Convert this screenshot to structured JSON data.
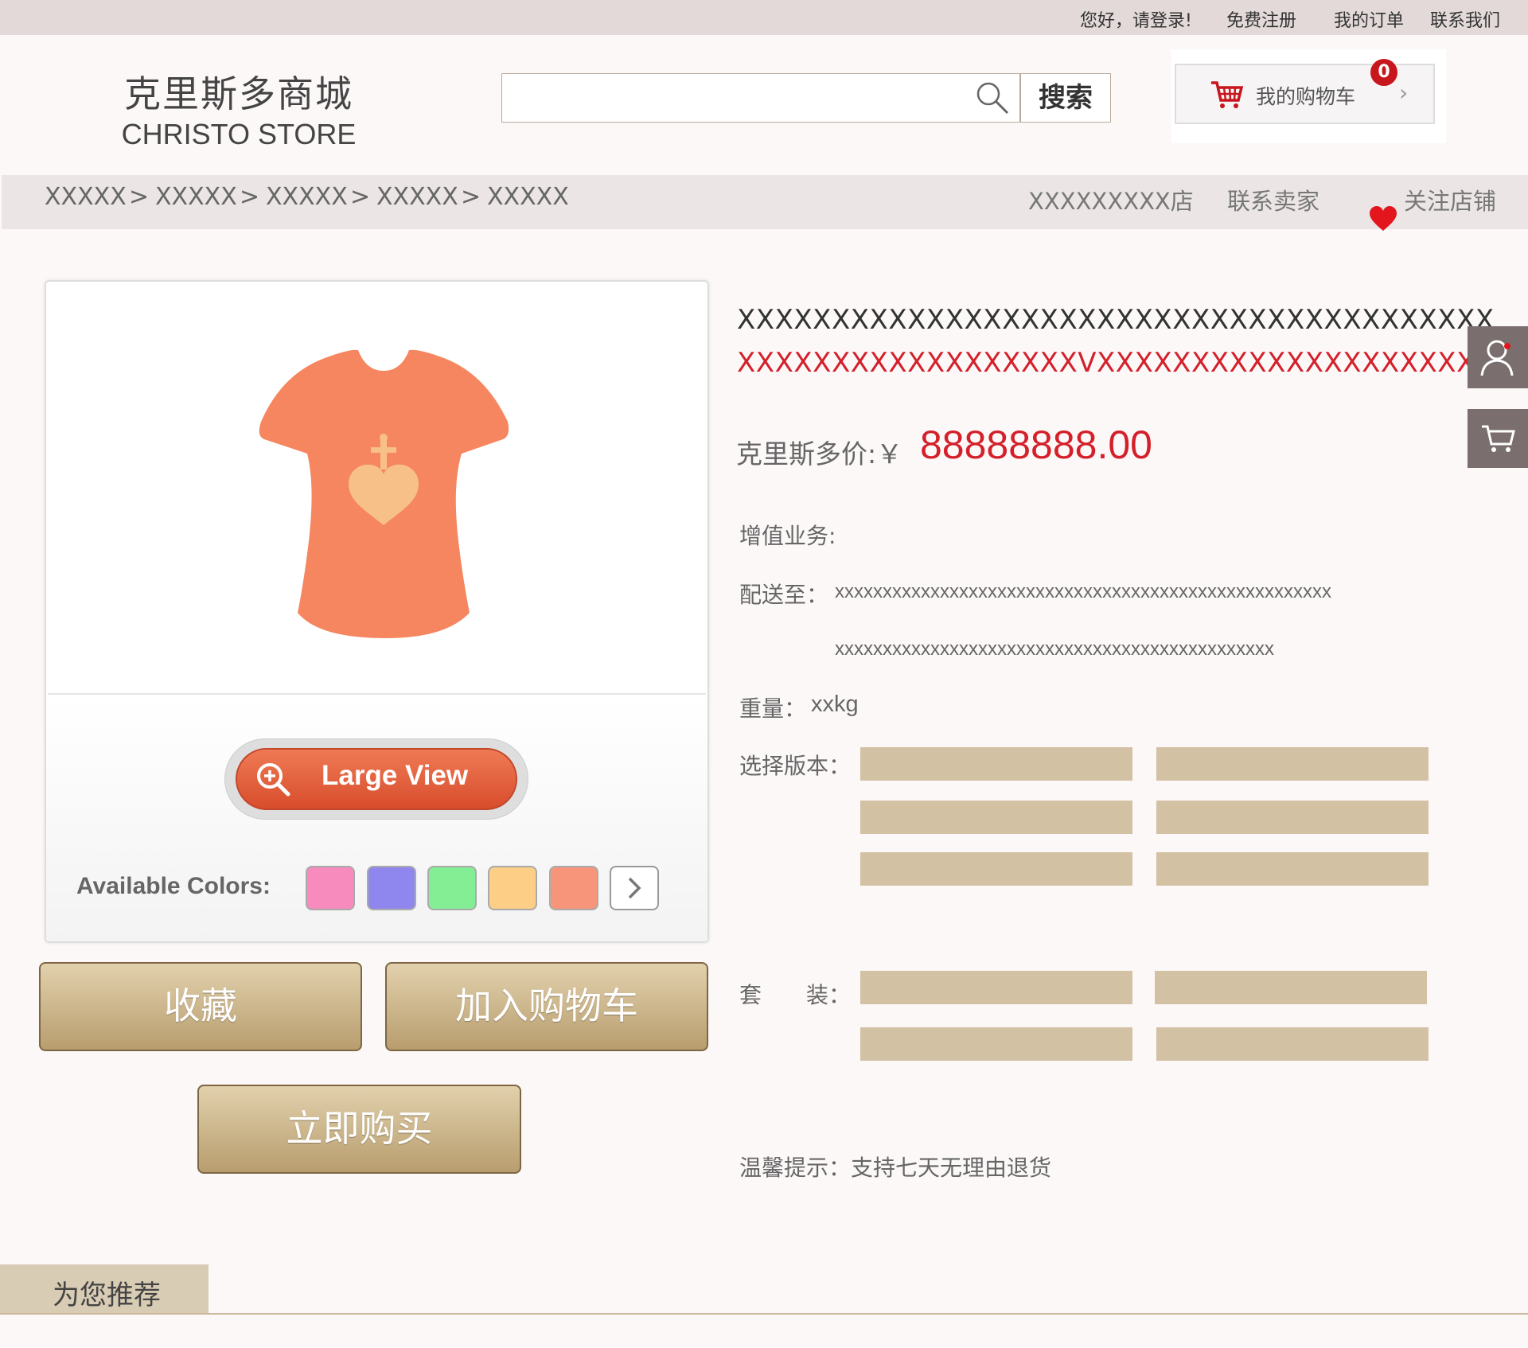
{
  "topbar": {
    "greeting": "您好，请登录!",
    "register": "免费注册",
    "orders": "我的订单",
    "contact": "联系我们"
  },
  "header": {
    "logo_cn": "克里斯多商城",
    "logo_en": "CHRISTO STORE",
    "search_placeholder": "",
    "search_button": "搜索",
    "cart_label": "我的购物车",
    "cart_count": "0",
    "cart_chevron": "›"
  },
  "breadcrumb": {
    "items": [
      "XXXXX",
      "XXXXX",
      "XXXXX",
      "XXXXX",
      "XXXXX"
    ],
    "separator": ">",
    "shop_name": "XXXXXXXXX店",
    "contact_seller": "联系卖家",
    "follow_shop": "关注店铺"
  },
  "gallery": {
    "large_view": "Large View",
    "colors_label": "Available Colors:",
    "colors": [
      "#f78bbd",
      "#8f87ee",
      "#84ee95",
      "#fcce86",
      "#f7957b"
    ],
    "next_icon": "chevron-right-icon"
  },
  "actions": {
    "favorite": "收藏",
    "add_to_cart": "加入购物车",
    "buy_now": "立即购买"
  },
  "product": {
    "title_line1": "XXXXXXXXXXXXXXXXXXXXXXXXXXXXXXXXXXXXXXXX",
    "title_line2": "XXXXXXXXXXXXXXXXXXVXXXXXXXXXXXXXXXXXXXXX",
    "price_label": "克里斯多价:￥",
    "price_value": "88888888.00",
    "value_added_label": "增值业务:",
    "ship_label": "配送至：",
    "ship_line1": "xxxxxxxxxxxxxxxxxxxxxxxxxxxxxxxxxxxxxxxxxxxxxxxxxxxx",
    "ship_line2": "xxxxxxxxxxxxxxxxxxxxxxxxxxxxxxxxxxxxxxxxxxxxxx",
    "weight_label": "重量：",
    "weight_value": "xxkg",
    "version_label": "选择版本：",
    "bundle_label": "套　　装：",
    "tip": "温馨提示：支持七天无理由退货"
  },
  "recommend": {
    "title": "为您推荐"
  },
  "colors": {
    "price_red": "#d4202a",
    "option_tan": "#d3c1a4",
    "button_gold": "#c8b287",
    "large_view_orange": "#e05f3b",
    "tshirt": "#f5865f"
  }
}
